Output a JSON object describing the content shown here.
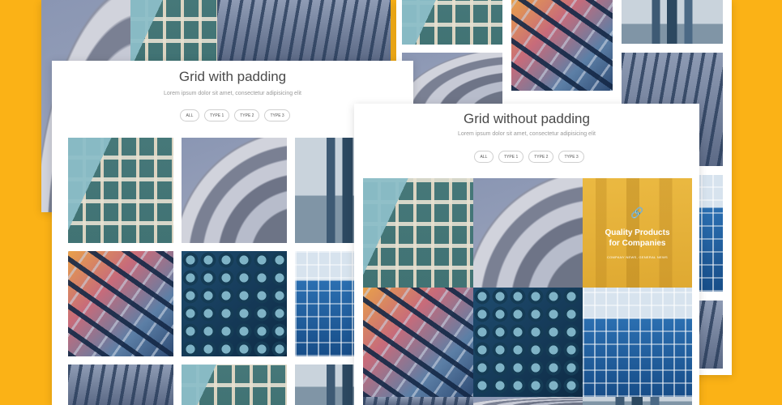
{
  "colors": {
    "background": "#fbb216",
    "card": "#ffffff",
    "title_text": "#4a4a4a",
    "subtitle_text": "#9a9a9a",
    "promo_overlay": "#e3ad35"
  },
  "grid_with_padding": {
    "title": "Grid with padding",
    "subtitle": "Lorem ipsum dolor sit amet, consectetur adipisicing elit",
    "filters": [
      "ALL",
      "TYPE 1",
      "TYPE 2",
      "TYPE 3"
    ]
  },
  "grid_without_padding": {
    "title": "Grid without padding",
    "subtitle": "Lorem ipsum dolor sit amet, consectetur adipisicing elit",
    "filters": [
      "ALL",
      "TYPE 1",
      "TYPE 2",
      "TYPE 3"
    ],
    "promo": {
      "icon": "link-icon",
      "title_line1": "Quality Products",
      "title_line2": "for Companies",
      "meta": "COMPANY NEWS, GENERAL NEWS"
    }
  },
  "tiles": {
    "icon_names": [
      "apartment-photo",
      "curved-facade-photo",
      "towers-photo",
      "glass-canopy-photo",
      "round-windows-photo",
      "blue-glass-photo"
    ]
  }
}
